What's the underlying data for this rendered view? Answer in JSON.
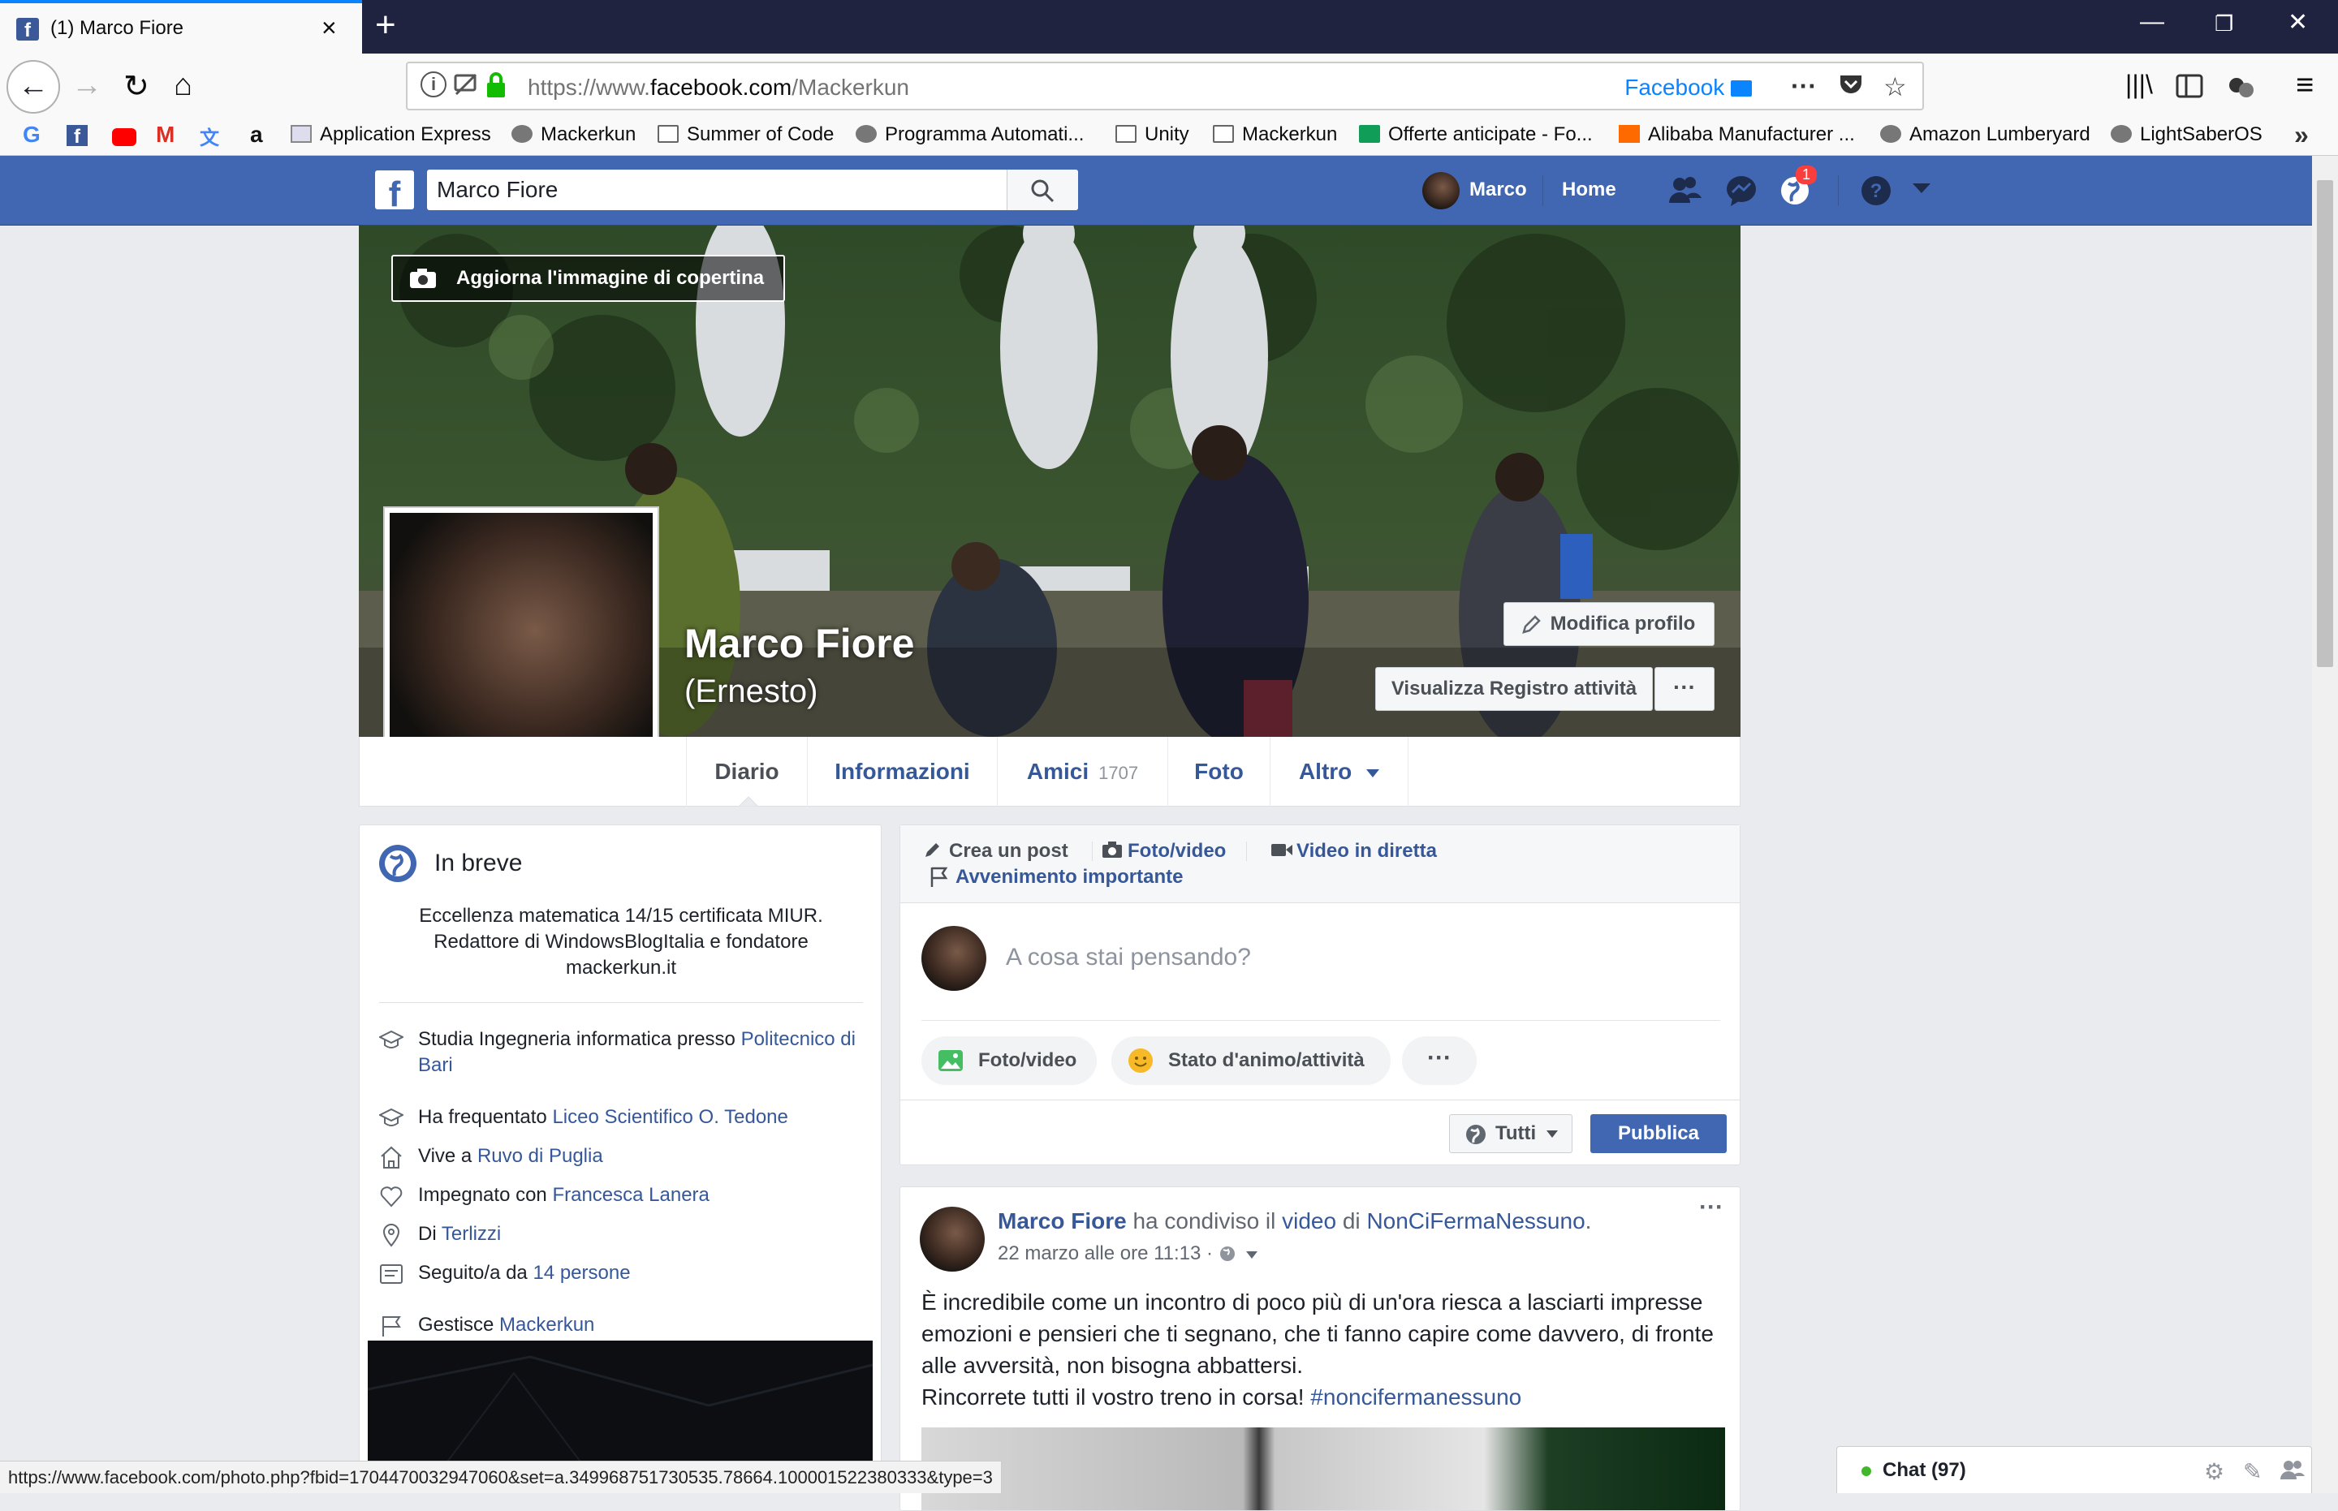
{
  "browser": {
    "tab_title": "(1) Marco Fiore",
    "url_prefix": "https://www.",
    "url_domain": "facebook.com",
    "url_path": "/Mackerkun",
    "container_label": "Facebook",
    "bookmarks": [
      {
        "label": "Application Express"
      },
      {
        "label": "Mackerkun"
      },
      {
        "label": "Summer of Code"
      },
      {
        "label": "Programma Automati..."
      },
      {
        "label": "Unity"
      },
      {
        "label": "Mackerkun"
      },
      {
        "label": "Offerte anticipate - Fo..."
      },
      {
        "label": "Alibaba Manufacturer ..."
      },
      {
        "label": "Amazon Lumberyard"
      },
      {
        "label": "LightSaberOS"
      }
    ],
    "status_url": "https://www.facebook.com/photo.php?fbid=1704470032947060&set=a.349968751730535.78664.100001522380333&type=3"
  },
  "fb_header": {
    "search_value": "Marco Fiore",
    "user_name": "Marco",
    "home_label": "Home",
    "notification_count": "1",
    "brand_color": "#4267b2"
  },
  "profile": {
    "update_cover_label": "Aggiorna l'immagine di copertina",
    "name": "Marco Fiore",
    "alt_name": "(Ernesto)",
    "edit_profile_label": "Modifica profilo",
    "activity_log_label": "Visualizza Registro attività",
    "more_label": "···",
    "tabs": [
      {
        "label": "Diario"
      },
      {
        "label": "Informazioni"
      },
      {
        "label": "Amici",
        "count": "1707"
      },
      {
        "label": "Foto"
      },
      {
        "label": "Altro"
      }
    ]
  },
  "intro": {
    "title": "In breve",
    "bio_line1": "Eccellenza matematica 14/15 certificata MIUR.",
    "bio_line2": "Redattore di WindowsBlogItalia e fondatore",
    "bio_line3": "mackerkun.it",
    "rows": [
      {
        "pre": "Studia Ingegneria informatica presso ",
        "link": "Politecnico di Bari"
      },
      {
        "pre": "Ha frequentato ",
        "link": "Liceo Scientifico O. Tedone"
      },
      {
        "pre": "Vive a ",
        "link": "Ruvo di Puglia"
      },
      {
        "pre": "Impegnato con ",
        "link": "Francesca Lanera"
      },
      {
        "pre": "Di ",
        "link": "Terlizzi"
      },
      {
        "pre": "Seguito/a da ",
        "link": "14 persone"
      },
      {
        "pre": "Gestisce ",
        "link": "Mackerkun"
      }
    ]
  },
  "composer": {
    "create_post": "Crea un post",
    "photo_video": "Foto/video",
    "live_video": "Video in diretta",
    "life_event": "Avvenimento importante",
    "placeholder": "A cosa stai pensando?",
    "pill_photo": "Foto/video",
    "pill_feeling": "Stato d'animo/attività",
    "pill_more": "···",
    "audience": "Tutti",
    "publish": "Pubblica"
  },
  "post": {
    "author": "Marco Fiore",
    "shared_text": " ha condiviso il ",
    "video_link": "video",
    "of_text": " di ",
    "page_link": "NonCiFermaNessuno",
    "period": ".",
    "date": "22 marzo alle ore 11:13 · ",
    "line1": "È incredibile come un incontro di poco più di un'ora riesca a lasciarti impresse",
    "line2": "emozioni e pensieri che ti segnano, che ti fanno capire come davvero, di fronte",
    "line3": "alle avversità, non bisogna abbattersi.",
    "line4": "Rincorrete tutti il vostro treno in corsa! ",
    "hashtag": "#noncifermanessuno",
    "more": "···"
  },
  "chat": {
    "label": "Chat (97)"
  }
}
